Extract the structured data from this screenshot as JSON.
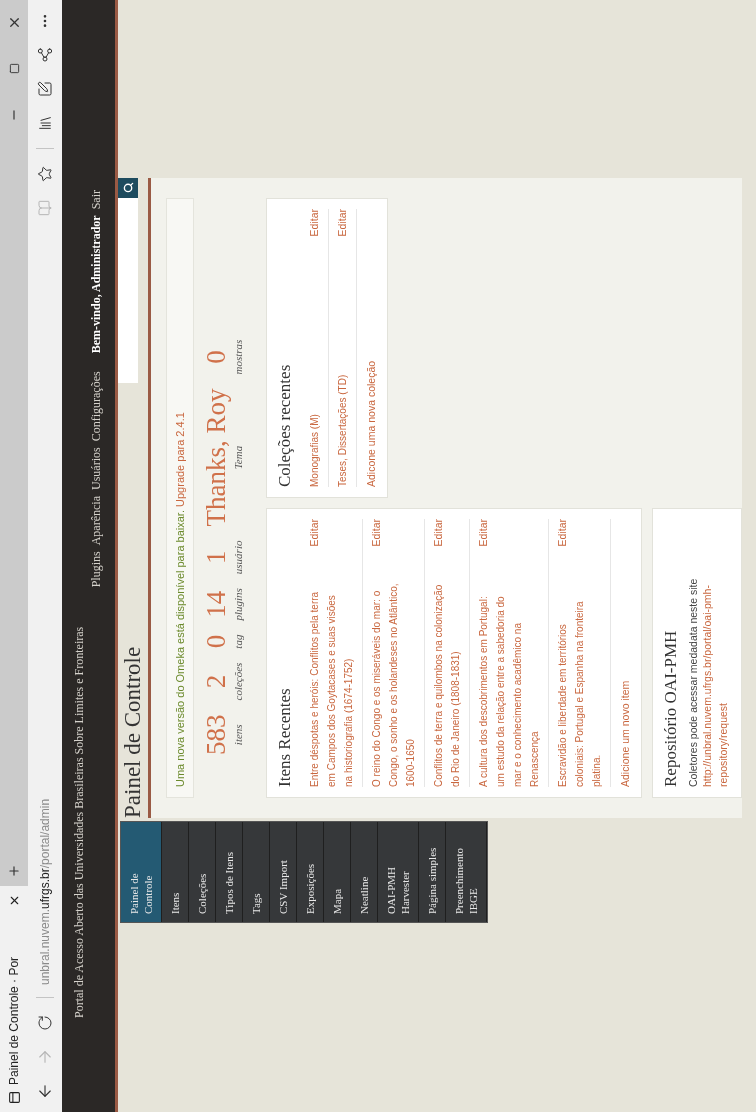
{
  "browser": {
    "tab_title": "Painel de Controle · Por",
    "url": {
      "pre": "unbral.nuvem.",
      "domain": "ufrgs.br",
      "path": "/portal/admin"
    }
  },
  "site": {
    "title": "Portal de Acesso Aberto das Universidades Brasileiras Sobre Limites e Fronteiras",
    "nav": [
      "Plugins",
      "Aparência",
      "Usuários",
      "Configurações"
    ],
    "welcome": "Bem-vindo, Administrador",
    "logout": "Sair"
  },
  "sidebar": {
    "items": [
      {
        "label": "Painel de Controle",
        "selected": true
      },
      {
        "label": "Itens",
        "selected": false
      },
      {
        "label": "Coleções",
        "selected": false
      },
      {
        "label": "Tipos de Itens",
        "selected": false
      },
      {
        "label": "Tags",
        "selected": false
      },
      {
        "label": "CSV Import",
        "selected": false
      },
      {
        "label": "Exposições",
        "selected": false
      },
      {
        "label": "Mapa",
        "selected": false
      },
      {
        "label": "Neatline",
        "selected": false
      },
      {
        "label": "OAI-PMH Harvester",
        "selected": false
      },
      {
        "label": "Página simples",
        "selected": false
      },
      {
        "label": "Preenchimento IBGE",
        "selected": false
      }
    ]
  },
  "page_title": "Painel de Controle",
  "alert": {
    "text": "Uma nova versão do Omeka está disponível para baixar.",
    "link": "Upgrade para 2.4.1"
  },
  "stats": [
    {
      "value": "583",
      "label": "itens"
    },
    {
      "value": "2",
      "label": "coleções"
    },
    {
      "value": "0",
      "label": "tag"
    },
    {
      "value": "14",
      "label": "plugins"
    },
    {
      "value": "1",
      "label": "usuário"
    },
    {
      "value": "Thanks, Roy",
      "label": "Tema"
    },
    {
      "value": "0",
      "label": "mostras"
    }
  ],
  "recent_items": {
    "title": "Itens Recentes",
    "items": [
      {
        "title": "Entre déspotas e heróis: Conflitos pela terra em Campos dos Goytacases e suas visões na historiografia (1674-1752)",
        "action": "Editar"
      },
      {
        "title": "O reino do Congo e os miseráveis do mar: o Congo, o sonho e os holandeses no Atlântico, 1600-1650",
        "action": "Editar"
      },
      {
        "title": "Conflitos de terra e quilombos na colonização do Rio de Janeiro (1808-1831)",
        "action": "Editar"
      },
      {
        "title": "A cultura dos descobrimentos em Portugal: um estudo da relação entre a sabedoria do mar e o conhecimento acadêmico na Renascença",
        "action": "Editar"
      },
      {
        "title": "Escravidão e liberdade em territórios coloniais: Portugal e Espanha na fronteira platina.",
        "action": "Editar"
      }
    ],
    "add_link": "Adicione um novo item"
  },
  "recent_collections": {
    "title": "Coleções recentes",
    "items": [
      {
        "title": "Monografias (M)",
        "action": "Editar"
      },
      {
        "title": "Teses, Dissertações (TD)",
        "action": "Editar"
      }
    ],
    "add_link": "Adicone uma nova coleção"
  },
  "oai": {
    "title": "Repositório OAI-PMH",
    "text": "Coletores pode acessar medadata neste site",
    "link": "http://unbral.nuvem.ufrgs.br/portal/oai-pmh-repository/request"
  }
}
